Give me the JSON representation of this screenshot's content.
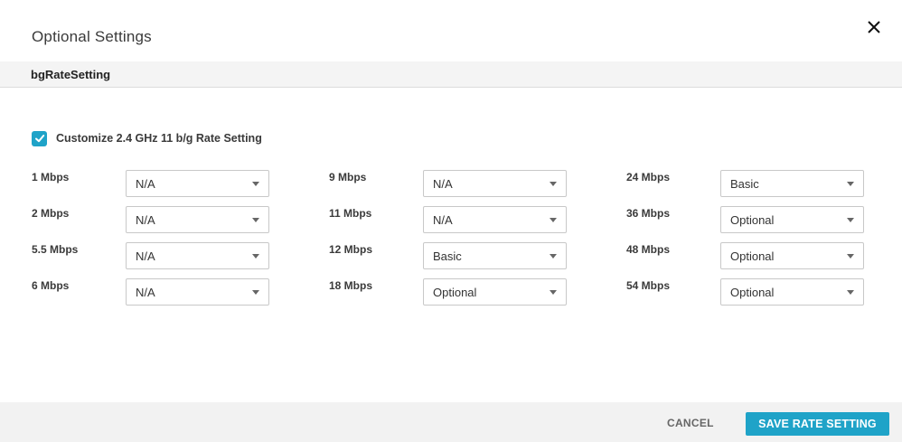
{
  "dialog": {
    "title": "Optional Settings",
    "close_icon": "close-icon"
  },
  "section": {
    "title": "bgRateSetting"
  },
  "customize": {
    "checked": true,
    "label": "Customize 2.4 GHz 11 b/g Rate Setting"
  },
  "rates": {
    "col1": [
      {
        "label": "1 Mbps",
        "value": "N/A"
      },
      {
        "label": "2 Mbps",
        "value": "N/A"
      },
      {
        "label": "5.5 Mbps",
        "value": "N/A"
      },
      {
        "label": "6 Mbps",
        "value": "N/A"
      }
    ],
    "col2": [
      {
        "label": "9 Mbps",
        "value": "N/A"
      },
      {
        "label": "11 Mbps",
        "value": "N/A"
      },
      {
        "label": "12 Mbps",
        "value": "Basic"
      },
      {
        "label": "18 Mbps",
        "value": "Optional"
      }
    ],
    "col3": [
      {
        "label": "24 Mbps",
        "value": "Basic"
      },
      {
        "label": "36 Mbps",
        "value": "Optional"
      },
      {
        "label": "48 Mbps",
        "value": "Optional"
      },
      {
        "label": "54 Mbps",
        "value": "Optional"
      }
    ]
  },
  "footer": {
    "cancel_label": "CANCEL",
    "save_label": "SAVE RATE SETTING"
  },
  "colors": {
    "accent": "#1fa3c8",
    "footer_bg": "#f2f2f2",
    "section_bg": "#f4f4f4"
  }
}
